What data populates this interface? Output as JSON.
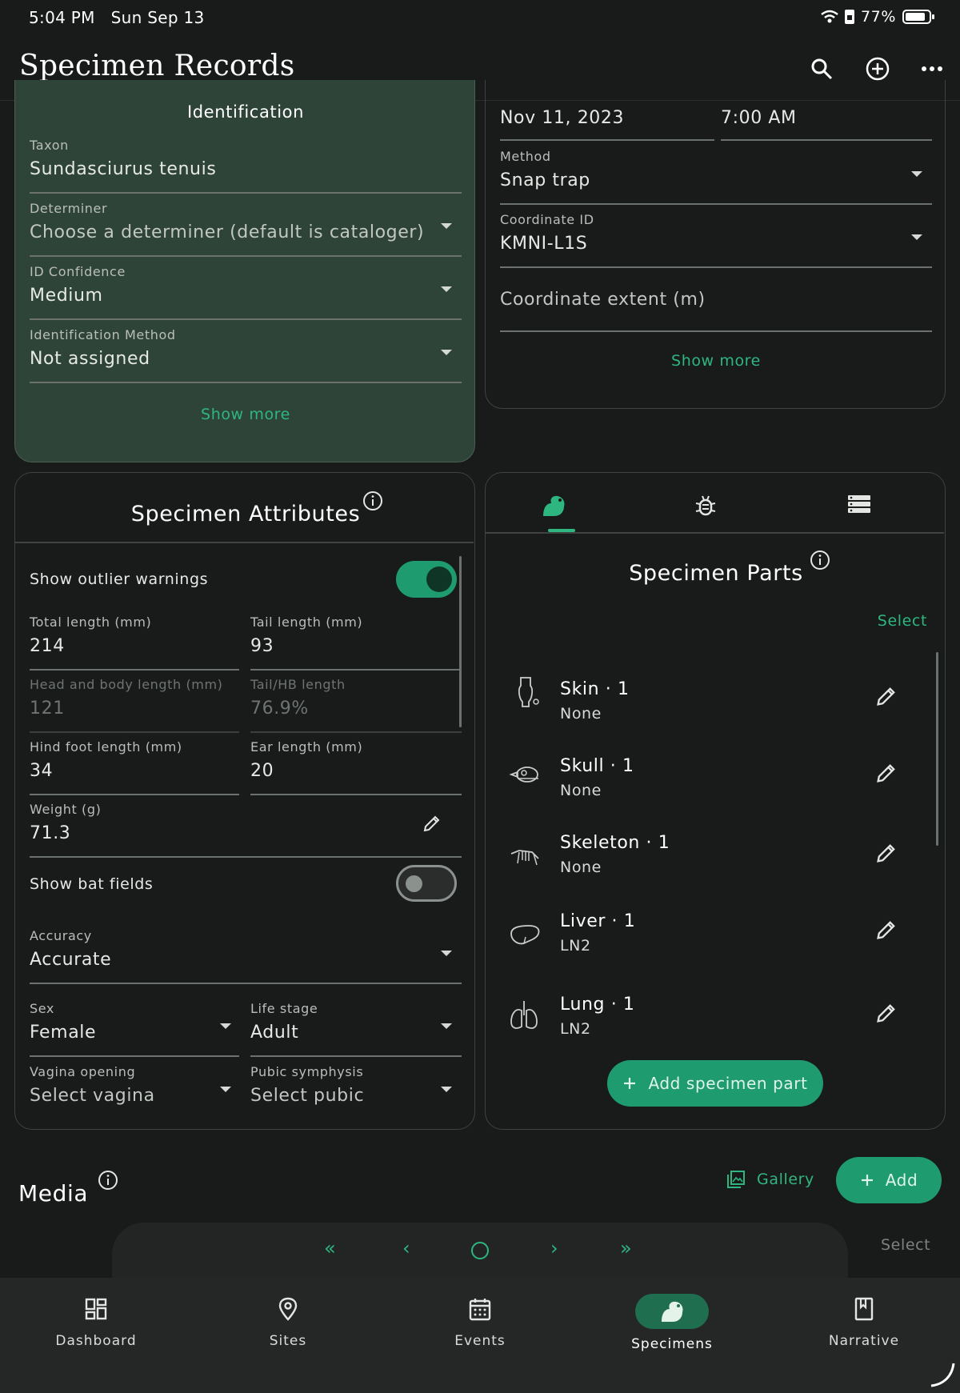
{
  "status_bar": {
    "time": "5:04 PM",
    "date": "Sun Sep 13",
    "battery": "77%"
  },
  "app_bar": {
    "title": "Specimen Records"
  },
  "identification": {
    "title": "Identification",
    "taxon_label": "Taxon",
    "taxon_value": "Sundasciurus tenuis",
    "determiner_label": "Determiner",
    "determiner_value": "Choose a determiner (default is cataloger)",
    "confidence_label": "ID Confidence",
    "confidence_value": "Medium",
    "method_label": "Identification Method",
    "method_value": "Not assigned",
    "show_more": "Show more"
  },
  "collecting": {
    "date_value": "Nov 11, 2023",
    "time_value": "7:00 AM",
    "method_label": "Method",
    "method_value": "Snap trap",
    "coordinate_id_label": "Coordinate ID",
    "coordinate_id_value": "KMNI-L1S",
    "coordinate_extent_placeholder": "Coordinate extent (m)",
    "show_more": "Show more"
  },
  "attributes": {
    "title": "Specimen Attributes",
    "outlier_label": "Show outlier warnings",
    "outlier_on": true,
    "total_length_label": "Total length (mm)",
    "total_length_value": "214",
    "tail_length_label": "Tail length (mm)",
    "tail_length_value": "93",
    "hb_length_label": "Head and body length (mm)",
    "hb_length_value": "121",
    "tail_hb_label": "Tail/HB length",
    "tail_hb_value": "76.9%",
    "hind_foot_label": "Hind foot length (mm)",
    "hind_foot_value": "34",
    "ear_label": "Ear length (mm)",
    "ear_value": "20",
    "weight_label": "Weight (g)",
    "weight_value": "71.3",
    "bat_label": "Show bat fields",
    "bat_on": false,
    "accuracy_label": "Accuracy",
    "accuracy_value": "Accurate",
    "sex_label": "Sex",
    "sex_value": "Female",
    "life_stage_label": "Life stage",
    "life_stage_value": "Adult",
    "vagina_label": "Vagina opening",
    "vagina_value": "Select vagina",
    "pubic_label": "Pubic symphysis",
    "pubic_value": "Select pubic"
  },
  "parts": {
    "title": "Specimen Parts",
    "select": "Select",
    "items": [
      {
        "name": "Skin · 1",
        "sub": "None",
        "icon": "skin-icon"
      },
      {
        "name": "Skull · 1",
        "sub": "None",
        "icon": "skull-icon"
      },
      {
        "name": "Skeleton · 1",
        "sub": "None",
        "icon": "skeleton-icon"
      },
      {
        "name": "Liver · 1",
        "sub": "LN2",
        "icon": "liver-icon"
      },
      {
        "name": "Lung · 1",
        "sub": "LN2",
        "icon": "lung-icon"
      }
    ],
    "add_button": "Add specimen part"
  },
  "media": {
    "title": "Media",
    "gallery": "Gallery",
    "add": "Add",
    "select": "Select",
    "pager": [
      "«",
      "‹",
      "○",
      "›",
      "»"
    ]
  },
  "bottom_nav": {
    "items": [
      {
        "label": "Dashboard",
        "icon": "dashboard-icon"
      },
      {
        "label": "Sites",
        "icon": "location-pin-icon"
      },
      {
        "label": "Events",
        "icon": "calendar-icon"
      },
      {
        "label": "Specimens",
        "icon": "squirrel-icon",
        "active": true
      },
      {
        "label": "Narrative",
        "icon": "bookmark-icon"
      }
    ]
  },
  "colors": {
    "accent": "#1f9c6f",
    "link": "#2eb681",
    "background": "#191b1a",
    "identification_card": "#2f4439"
  }
}
